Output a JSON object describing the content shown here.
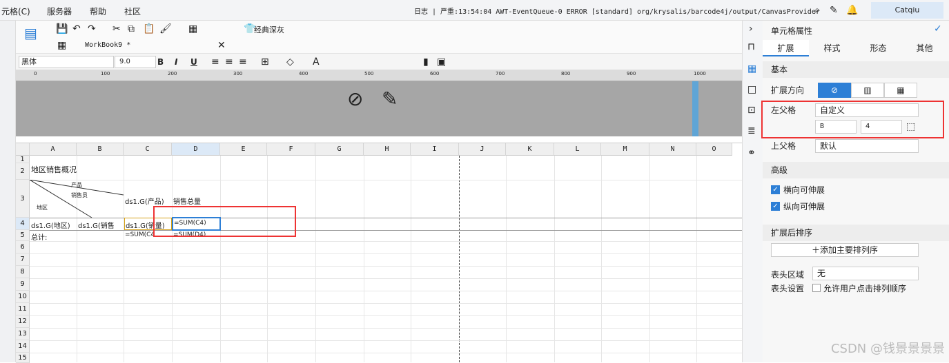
{
  "menu": {
    "items": [
      "元格(C)",
      "服务器",
      "帮助",
      "社区"
    ],
    "log": "日志 | 严重:13:54:04 AWT-EventQueue-0 ERROR [standard] org/krysalis/barcode4j/output/CanvasProvider",
    "user": "Catqiu"
  },
  "toolbar": {
    "skin_label": "经典深灰",
    "tab_name": "WorkBook9 *",
    "font_name": "黑体",
    "font_size": "9.0",
    "bold": "B",
    "italic": "I",
    "underline": "U"
  },
  "ruler": {
    "ticks": [
      "0",
      "100",
      "200",
      "300",
      "400",
      "500",
      "600",
      "700",
      "800",
      "900",
      "1000"
    ]
  },
  "sheet": {
    "columns": [
      "A",
      "B",
      "C",
      "D",
      "E",
      "F",
      "G",
      "H",
      "I",
      "J",
      "K",
      "L",
      "M",
      "N",
      "O"
    ],
    "rows": [
      "1",
      "2",
      "3",
      "4",
      "5",
      "6",
      "7",
      "8",
      "9",
      "10",
      "11",
      "12",
      "13",
      "14",
      "15"
    ],
    "cells": {
      "title": "地区销售概况",
      "diag_product": "产品",
      "diag_salesman": "销售员",
      "diag_region": "地区",
      "c3": "ds1.G(产品)",
      "d3": "销售总量",
      "a4": "ds1.G(地区)",
      "b4": "ds1.G(销售",
      "c4": "ds1.G(销量)",
      "d4": "=SUM(C4)",
      "a5": "总计:",
      "c5": "=SUM(C4",
      "d5": "=SUM(D4)"
    }
  },
  "panel": {
    "title": "单元格属性",
    "tabs": [
      "扩展",
      "样式",
      "形态",
      "其他"
    ],
    "basic": {
      "title": "基本",
      "expand_dir_label": "扩展方向",
      "left_parent_label": "左父格",
      "left_parent_value": "自定义",
      "left_col": "B",
      "left_row": "4",
      "top_parent_label": "上父格",
      "top_parent_value": "默认"
    },
    "advanced": {
      "title": "高级",
      "h_expand": "横向可伸展",
      "v_expand": "纵向可伸展"
    },
    "sort": {
      "title": "扩展后排序",
      "add_label": "添加主要排列序"
    },
    "header_area_label": "表头区域",
    "header_area_value": "无",
    "header_setting_label": "表头设置",
    "header_setting_value": "允许用户点击排列顺序"
  },
  "watermark": "CSDN @钱景景景景",
  "colors": {
    "accent": "#2d7fd6",
    "highlight": "#e33333",
    "header_gray": "#a6a6a6"
  }
}
